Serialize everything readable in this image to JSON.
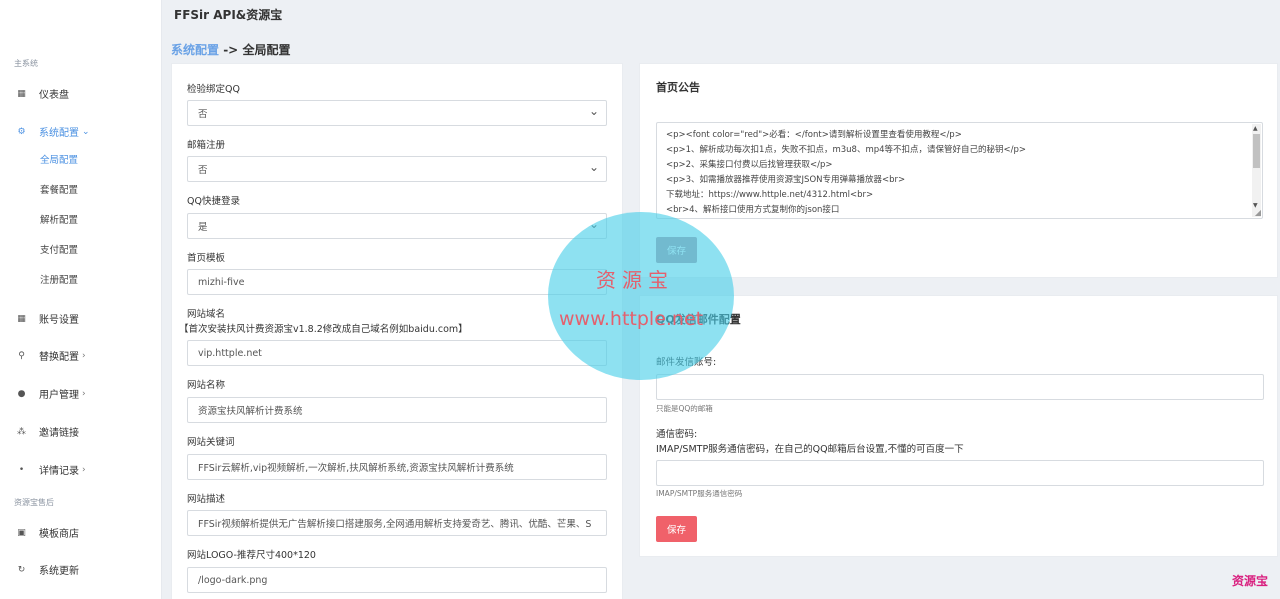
{
  "header": {
    "brand": "FFSir API&资源宝"
  },
  "breadcrumb": {
    "parent": "系统配置",
    "separator": "->",
    "current": "全局配置"
  },
  "sidebar": {
    "section_main": "主系统",
    "section_extra": "资源宝售后",
    "items": [
      {
        "label": "仪表盘",
        "icon": "dashboard-icon"
      },
      {
        "label": "系统配置",
        "icon": "settings-icon",
        "chevron": "⌄"
      },
      {
        "label": "账号设置",
        "icon": "account-icon"
      },
      {
        "label": "替换配置",
        "icon": "search-icon",
        "chevron": "›"
      },
      {
        "label": "用户管理",
        "icon": "user-icon",
        "chevron": "›"
      },
      {
        "label": "邀请链接",
        "icon": "invite-icon"
      },
      {
        "label": "详情记录",
        "icon": "record-icon",
        "chevron": "›"
      },
      {
        "label": "模板商店",
        "icon": "store-icon"
      },
      {
        "label": "系统更新",
        "icon": "update-icon"
      }
    ],
    "sub_items": [
      "全局配置",
      "套餐配置",
      "解析配置",
      "支付配置",
      "注册配置"
    ]
  },
  "global_config": {
    "qq_bind": {
      "label": "检验绑定QQ",
      "value": "否"
    },
    "email_register": {
      "label": "邮箱注册",
      "value": "否"
    },
    "qq_login": {
      "label": "QQ快捷登录",
      "value": "是"
    },
    "homepage_template": {
      "label": "首页模板",
      "value": "mizhi-five"
    },
    "site_domain": {
      "label": "网站域名",
      "note": "【首次安装扶风计费资源宝v1.8.2修改成自己域名例如baidu.com】",
      "value": "vip.httple.net"
    },
    "site_name": {
      "label": "网站名称",
      "value": "资源宝扶风解析计费系统"
    },
    "site_keywords": {
      "label": "网站关键词",
      "value": "FFSir云解析,vip视频解析,一次解析,扶风解析系统,资源宝扶风解析计费系统"
    },
    "site_description": {
      "label": "网站描述",
      "value": "FFSir视频解析提供无广告解析接口搭建服务,全网通用解析支持爱奇艺、腾讯、优酷、芒果、S"
    },
    "site_logo": {
      "label": "网站LOGO-推荐尺寸400*120",
      "value": "/logo-dark.png"
    }
  },
  "announcement": {
    "title": "首页公告",
    "lines": [
      "<p><font color=\"red\">必看：</font>请到解析设置里查看使用教程</p>",
      "<p>1、解析成功每次扣1点，失败不扣点，m3u8、mp4等不扣点，请保管好自己的秘钥</p>",
      "<p>2、采集接口付费以后找管理获取</p>",
      "<p>3、如需播放器推荐使用资源宝JSON专用弹幕播放器<br>",
      "下载地址：https://www.httple.net/4312.html<br>",
      "<br>4、解析接口使用方式复制你的json接口"
    ],
    "save_label": "保存"
  },
  "mail_config": {
    "title": "QQ发信邮件配置",
    "account_label": "邮件发信账号:",
    "account_help": "只能是QQ的邮箱",
    "password_label": "通信密码:",
    "password_desc": "IMAP/SMTP服务通信密码，在自己的QQ邮箱后台设置,不懂的可百度一下",
    "password_help": "IMAP/SMTP服务通信密码",
    "save_label": "保存"
  },
  "watermark": {
    "line1": "资源宝",
    "line2": "www.httple.net",
    "corner": "资源宝"
  },
  "colors": {
    "accent": "#4a90e2",
    "save_disabled": "#b59aa6",
    "save_red": "#f0616a",
    "watermark_circle": "#48cfe8",
    "watermark_text": "#e4606d"
  }
}
